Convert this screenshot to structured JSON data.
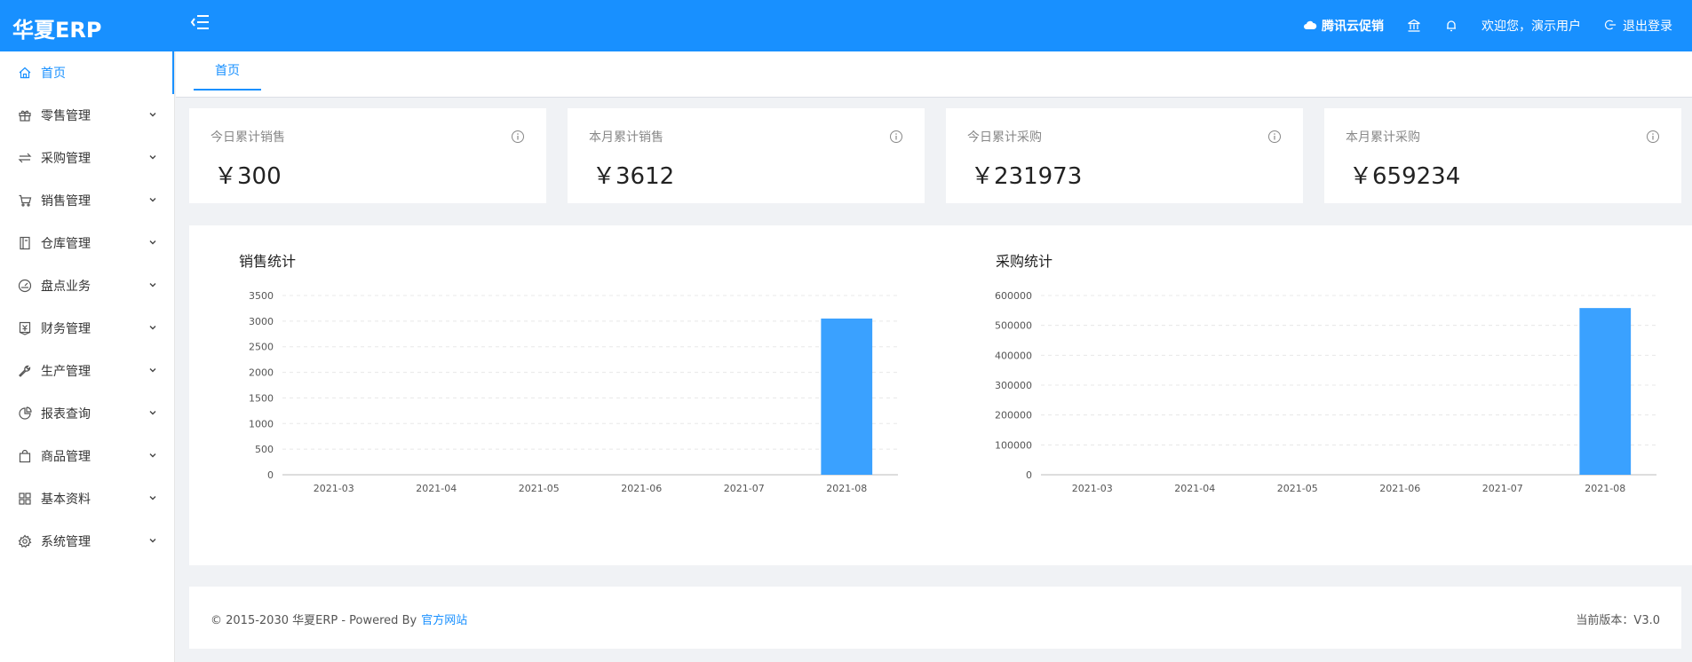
{
  "header": {
    "logo": "华夏ERP",
    "promo_label": "腾讯云促销",
    "welcome_label": "欢迎您，演示用户",
    "logout_label": "退出登录"
  },
  "sidebar": {
    "items": [
      {
        "label": "首页",
        "icon": "home-icon"
      },
      {
        "label": "零售管理",
        "icon": "gift-icon"
      },
      {
        "label": "采购管理",
        "icon": "swap-icon"
      },
      {
        "label": "销售管理",
        "icon": "cart-icon"
      },
      {
        "label": "仓库管理",
        "icon": "book-icon"
      },
      {
        "label": "盘点业务",
        "icon": "dashboard-icon"
      },
      {
        "label": "财务管理",
        "icon": "money-collect-icon"
      },
      {
        "label": "生产管理",
        "icon": "tool-icon"
      },
      {
        "label": "报表查询",
        "icon": "pie-chart-icon"
      },
      {
        "label": "商品管理",
        "icon": "shopping-bag-icon"
      },
      {
        "label": "基本资料",
        "icon": "appstore-icon"
      },
      {
        "label": "系统管理",
        "icon": "setting-icon"
      }
    ]
  },
  "tabs": [
    {
      "label": "首页"
    }
  ],
  "stats": [
    {
      "label": "今日累计销售",
      "value": "￥300"
    },
    {
      "label": "本月累计销售",
      "value": "￥3612"
    },
    {
      "label": "今日累计采购",
      "value": "￥231973"
    },
    {
      "label": "本月累计采购",
      "value": "￥659234"
    }
  ],
  "colors": {
    "primary": "#1890ff",
    "bar": "#3aa1ff"
  },
  "chart_data": [
    {
      "type": "bar",
      "title": "销售统计",
      "categories": [
        "2021-03",
        "2021-04",
        "2021-05",
        "2021-06",
        "2021-07",
        "2021-08"
      ],
      "values": [
        0,
        0,
        0,
        0,
        0,
        3050
      ],
      "ylim": [
        0,
        3500
      ],
      "yticks": [
        0,
        500,
        1000,
        1500,
        2000,
        2500,
        3000,
        3500
      ],
      "grid": true
    },
    {
      "type": "bar",
      "title": "采购统计",
      "categories": [
        "2021-03",
        "2021-04",
        "2021-05",
        "2021-06",
        "2021-07",
        "2021-08"
      ],
      "values": [
        0,
        0,
        0,
        0,
        0,
        558000
      ],
      "ylim": [
        0,
        600000
      ],
      "yticks": [
        0,
        100000,
        200000,
        300000,
        400000,
        500000,
        600000
      ],
      "grid": true
    }
  ],
  "footer": {
    "copyright": "© 2015-2030 华夏ERP - Powered By",
    "link_label": "官方网站",
    "version": "当前版本：V3.0"
  }
}
